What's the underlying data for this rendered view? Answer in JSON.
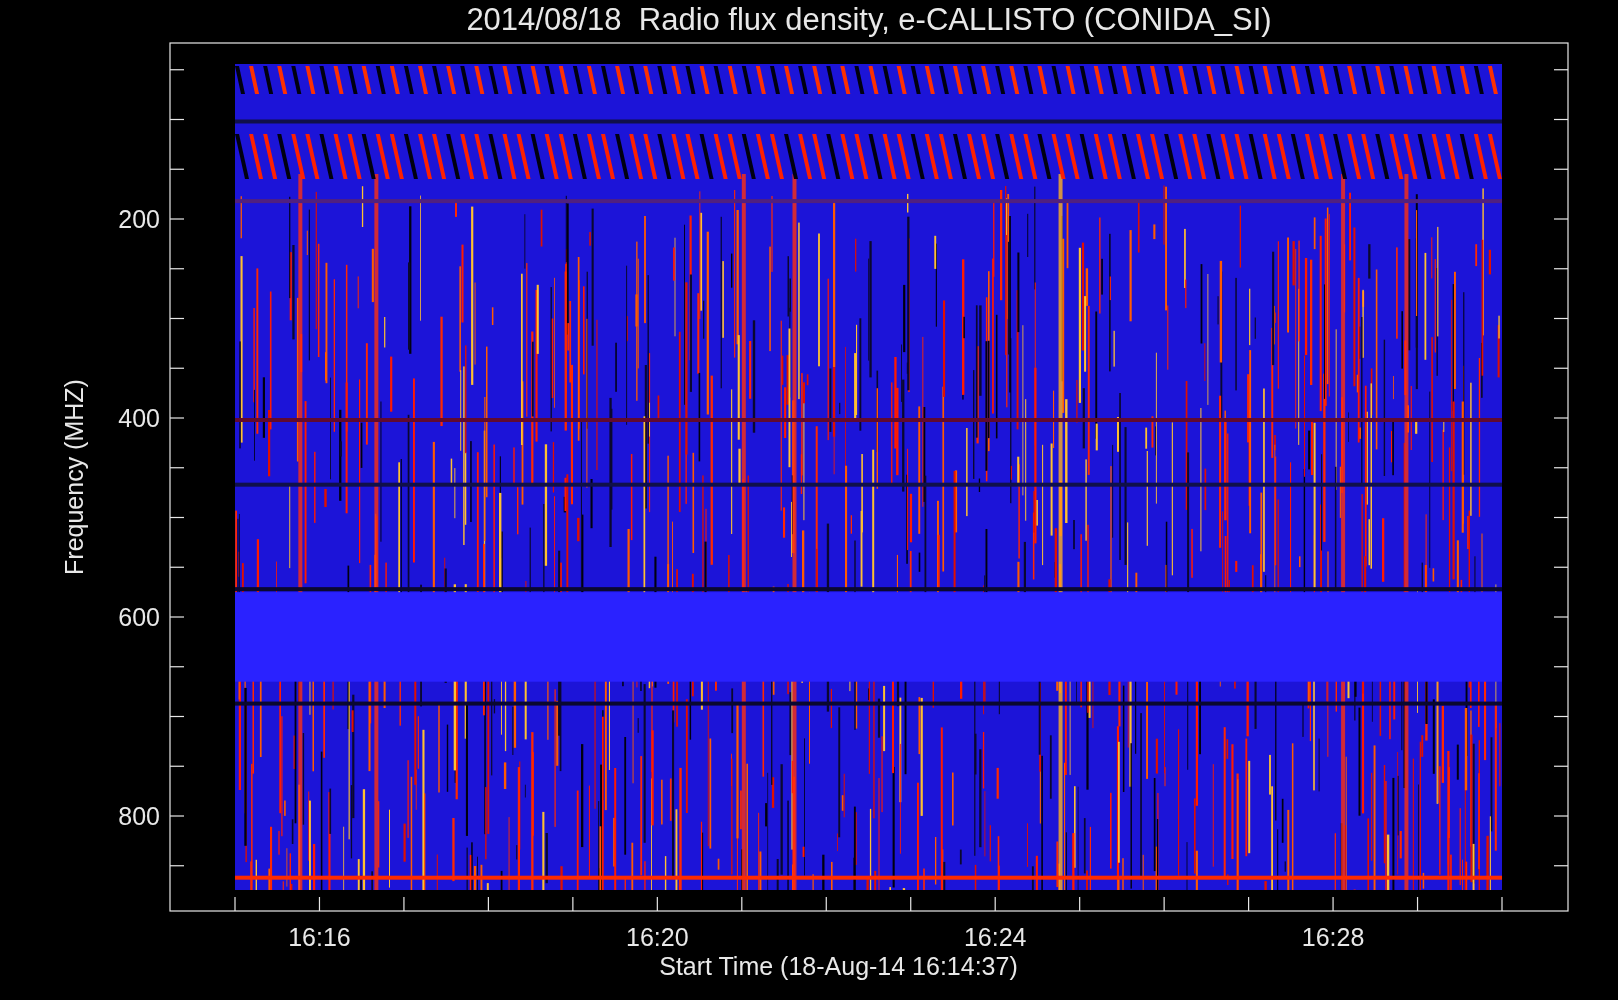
{
  "title": "2014/08/18  Radio flux density, e-CALLISTO (CONIDA_SI)",
  "y_axis": {
    "label": "Frequency (MHZ)",
    "tick_labels": [
      "200",
      "400",
      "600",
      "800"
    ]
  },
  "x_axis": {
    "label": "Start Time (18-Aug-14 16:14:37)",
    "tick_labels": [
      "16:16",
      "16:20",
      "16:24",
      "16:28"
    ]
  }
}
